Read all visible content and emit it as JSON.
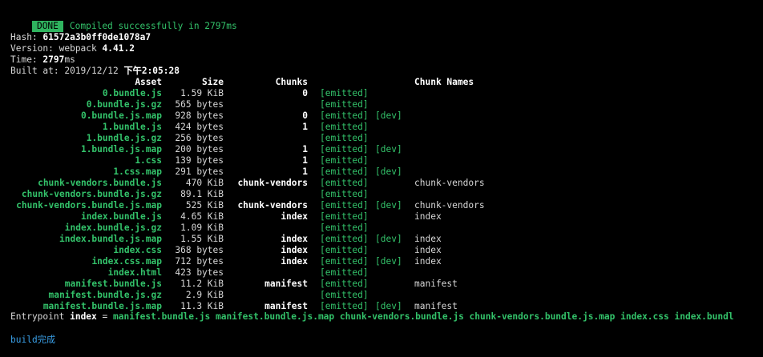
{
  "status": {
    "badge": "DONE",
    "message": "Compiled successfully in 2797ms"
  },
  "info": {
    "hash_label": "Hash: ",
    "hash_value": "61572a3b0ff0de1078a7",
    "version_label": "Version: webpack ",
    "version_value": "4.41.2",
    "time_label": "Time: ",
    "time_value": "2797",
    "time_unit": "ms",
    "built_label": "Built at: 2019/12/12 ",
    "built_value": "下午2:05:28"
  },
  "headers": {
    "asset": "Asset",
    "size": "Size",
    "chunks": "Chunks",
    "chunk_names": "Chunk Names"
  },
  "rows": [
    {
      "asset": "0.bundle.js",
      "size": "1.59 KiB",
      "chunks": "0",
      "emitted": "[emitted]",
      "dev": "",
      "names": ""
    },
    {
      "asset": "0.bundle.js.gz",
      "size": "565 bytes",
      "chunks": "",
      "emitted": "[emitted]",
      "dev": "",
      "names": ""
    },
    {
      "asset": "0.bundle.js.map",
      "size": "928 bytes",
      "chunks": "0",
      "emitted": "[emitted]",
      "dev": "[dev]",
      "names": ""
    },
    {
      "asset": "1.bundle.js",
      "size": "424 bytes",
      "chunks": "1",
      "emitted": "[emitted]",
      "dev": "",
      "names": ""
    },
    {
      "asset": "1.bundle.js.gz",
      "size": "256 bytes",
      "chunks": "",
      "emitted": "[emitted]",
      "dev": "",
      "names": ""
    },
    {
      "asset": "1.bundle.js.map",
      "size": "200 bytes",
      "chunks": "1",
      "emitted": "[emitted]",
      "dev": "[dev]",
      "names": ""
    },
    {
      "asset": "1.css",
      "size": "139 bytes",
      "chunks": "1",
      "emitted": "[emitted]",
      "dev": "",
      "names": ""
    },
    {
      "asset": "1.css.map",
      "size": "291 bytes",
      "chunks": "1",
      "emitted": "[emitted]",
      "dev": "[dev]",
      "names": ""
    },
    {
      "asset": "chunk-vendors.bundle.js",
      "size": "470 KiB",
      "chunks": "chunk-vendors",
      "emitted": "[emitted]",
      "dev": "",
      "names": "chunk-vendors"
    },
    {
      "asset": "chunk-vendors.bundle.js.gz",
      "size": "89.1 KiB",
      "chunks": "",
      "emitted": "[emitted]",
      "dev": "",
      "names": ""
    },
    {
      "asset": "chunk-vendors.bundle.js.map",
      "size": "525 KiB",
      "chunks": "chunk-vendors",
      "emitted": "[emitted]",
      "dev": "[dev]",
      "names": "chunk-vendors"
    },
    {
      "asset": "index.bundle.js",
      "size": "4.65 KiB",
      "chunks": "index",
      "emitted": "[emitted]",
      "dev": "",
      "names": "index"
    },
    {
      "asset": "index.bundle.js.gz",
      "size": "1.09 KiB",
      "chunks": "",
      "emitted": "[emitted]",
      "dev": "",
      "names": ""
    },
    {
      "asset": "index.bundle.js.map",
      "size": "1.55 KiB",
      "chunks": "index",
      "emitted": "[emitted]",
      "dev": "[dev]",
      "names": "index"
    },
    {
      "asset": "index.css",
      "size": "368 bytes",
      "chunks": "index",
      "emitted": "[emitted]",
      "dev": "",
      "names": "index"
    },
    {
      "asset": "index.css.map",
      "size": "712 bytes",
      "chunks": "index",
      "emitted": "[emitted]",
      "dev": "[dev]",
      "names": "index"
    },
    {
      "asset": "index.html",
      "size": "423 bytes",
      "chunks": "",
      "emitted": "[emitted]",
      "dev": "",
      "names": ""
    },
    {
      "asset": "manifest.bundle.js",
      "size": "11.2 KiB",
      "chunks": "manifest",
      "emitted": "[emitted]",
      "dev": "",
      "names": "manifest"
    },
    {
      "asset": "manifest.bundle.js.gz",
      "size": "2.9 KiB",
      "chunks": "",
      "emitted": "[emitted]",
      "dev": "",
      "names": ""
    },
    {
      "asset": "manifest.bundle.js.map",
      "size": "11.3 KiB",
      "chunks": "manifest",
      "emitted": "[emitted]",
      "dev": "[dev]",
      "names": "manifest"
    }
  ],
  "entrypoint": {
    "label": "Entrypoint ",
    "name": "index",
    "equals": " = ",
    "files": "manifest.bundle.js manifest.bundle.js.map chunk-vendors.bundle.js chunk-vendors.bundle.js.map index.css index.bundl"
  },
  "footer": {
    "message": "build完成"
  },
  "colors": {
    "background": "#000000",
    "green": "#33c26a",
    "badge_bg": "#2fb45f",
    "blue": "#3aa0e8"
  }
}
